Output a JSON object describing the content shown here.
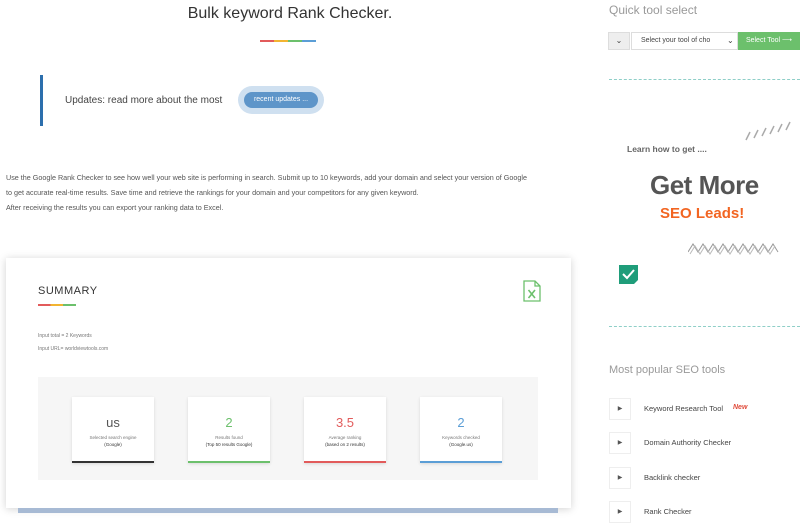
{
  "page": {
    "title": "Bulk keyword Rank Checker.",
    "updates_text": "Updates: read more about the most",
    "updates_button": "recent updates ..."
  },
  "description": [
    "Use the Google Rank Checker to see how well your web site is performing in search. Submit up to 10 keywords, add your domain and select your version of Google",
    "to get accurate real-time results. Save time and retrieve the rankings for your domain and your competitors for any given keyword.",
    "After receiving the results you can export your ranking data to Excel."
  ],
  "summary": {
    "title": "SUMMARY",
    "input_total": "Input total = 2 Keywords",
    "input_url": "Input URL= worldviewtools.com",
    "export_icon": "excel-icon",
    "stats": [
      {
        "value": "us",
        "label": "Selected search engine",
        "sub": "(Google)",
        "color": "#333333",
        "value_color": "#555555"
      },
      {
        "value": "2",
        "label": "Results found",
        "sub": "(Top 50 results Google)",
        "color": "#6cc06c",
        "value_color": "#6cc06c"
      },
      {
        "value": "3.5",
        "label": "Average ranking",
        "sub": "(based on 2 results)",
        "color": "#e25b5b",
        "value_color": "#e25b5b"
      },
      {
        "value": "2",
        "label": "Keywords checked",
        "sub": "(Google.us)",
        "color": "#5b9ed6",
        "value_color": "#5b9ed6"
      }
    ]
  },
  "sidebar": {
    "quick_tool_title": "Quick tool select",
    "select_placeholder": "Select your tool of cho",
    "select_button": "Select Tool ⟶",
    "ad": {
      "learn": "Learn how to get ....",
      "headline": "Get More",
      "subheadline": "SEO Leads!"
    },
    "popular_title": "Most popular SEO tools",
    "popular_items": [
      {
        "label": "Keyword Research Tool",
        "badge": "New"
      },
      {
        "label": "Domain Authority Checker",
        "badge": ""
      },
      {
        "label": "Backlink checker",
        "badge": ""
      },
      {
        "label": "Rank Checker",
        "badge": ""
      }
    ]
  },
  "colors": {
    "accent_green": "#6cc06c",
    "accent_blue": "#2c6fad",
    "accent_orange": "#f26522"
  }
}
